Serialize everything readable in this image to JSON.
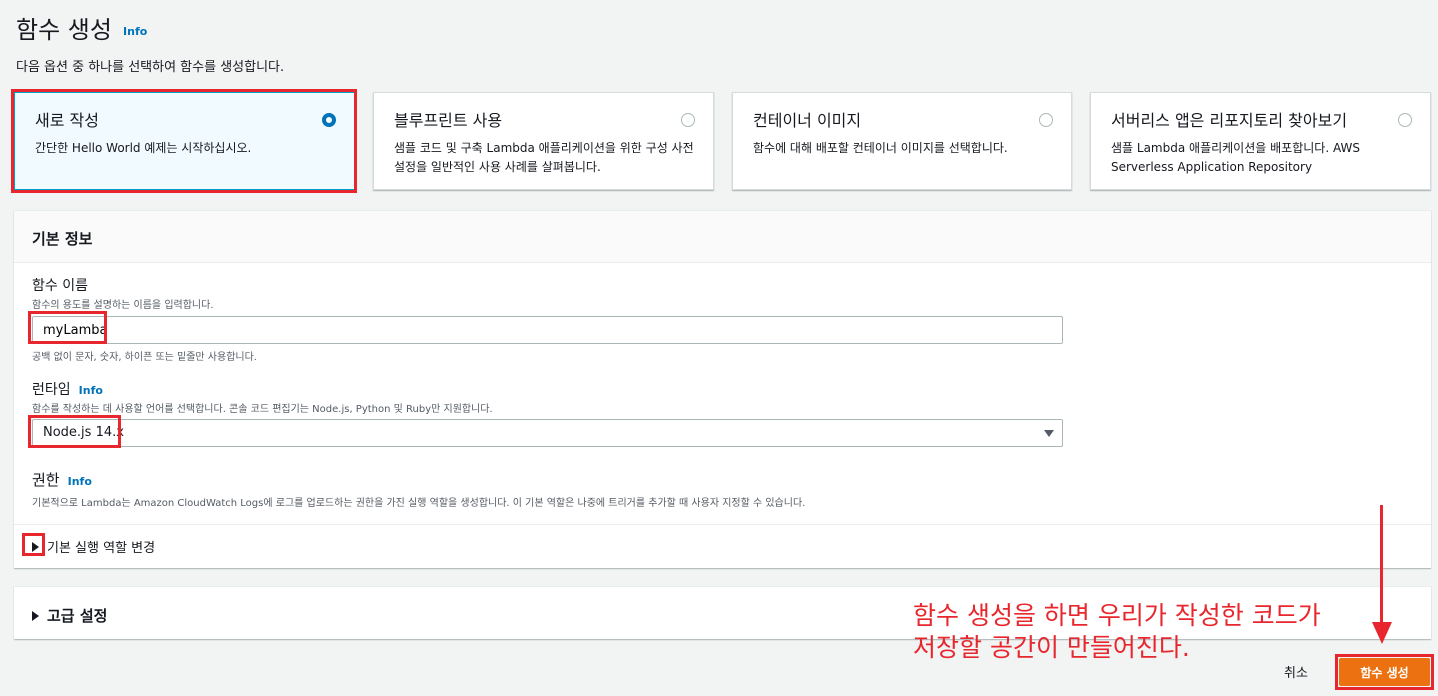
{
  "header": {
    "title": "함수 생성",
    "info": "Info",
    "subtitle": "다음 옵션 중 하나를 선택하여 함수를 생성합니다."
  },
  "options": [
    {
      "title": "새로 작성",
      "desc": "간단한 Hello World 예제는 시작하십시오.",
      "selected": true
    },
    {
      "title": "블루프린트 사용",
      "desc": "샘플 코드 및 구축 Lambda 애플리케이션을 위한 구성 사전 설정을 일반적인 사용 사례를 살펴봅니다.",
      "selected": false
    },
    {
      "title": "컨테이너 이미지",
      "desc": "함수에 대해 배포할 컨테이너 이미지를 선택합니다.",
      "selected": false
    },
    {
      "title": "서버리스 앱은 리포지토리 찾아보기",
      "desc": "샘플 Lambda 애플리케이션을 배포합니다. AWS Serverless Application Repository",
      "selected": false
    }
  ],
  "basic": {
    "header": "기본 정보",
    "name_label": "함수 이름",
    "name_desc": "함수의 용도를 설명하는 이름을 입력합니다.",
    "name_value": "myLamba",
    "name_hint": "공백 없이 문자, 숫자, 하이픈 또는 밑줄만 사용합니다.",
    "runtime_label": "런타임",
    "runtime_info": "Info",
    "runtime_desc": "함수를 작성하는 데 사용할 언어를 선택합니다. 콘솔 코드 편집기는 Node.js, Python 및 Ruby만 지원합니다.",
    "runtime_value": "Node.js 14.x",
    "perm_label": "권한",
    "perm_info": "Info",
    "perm_desc": "기본적으로 Lambda는 Amazon CloudWatch Logs에 로그를 업로드하는 권한을 가진 실행 역할을 생성합니다. 이 기본 역할은 나중에 트리거를 추가할 때 사용자 지정할 수 있습니다.",
    "role_toggle": "기본 실행 역할 변경"
  },
  "advanced": {
    "label": "고급 설정"
  },
  "annotation": {
    "line1": "함수 생성을 하면 우리가 작성한 코드가",
    "line2": "저장할 공간이 만들어진다."
  },
  "footer": {
    "cancel": "취소",
    "create": "함수 생성"
  },
  "colors": {
    "primary": "#ec7211",
    "link": "#0073bb",
    "highlight": "#e8262d"
  }
}
